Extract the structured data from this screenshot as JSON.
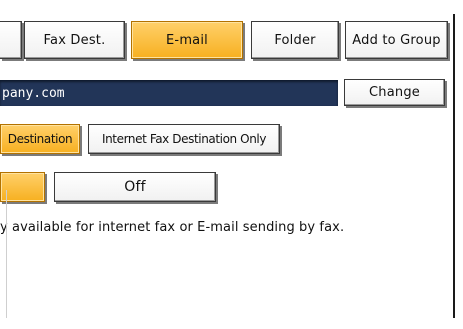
{
  "tabs": {
    "fax_dest": "Fax Dest.",
    "email": "E-mail",
    "folder": "Folder",
    "add_to_group": "Add to Group"
  },
  "address": {
    "value": "pany.com"
  },
  "change_label": "Change",
  "destination_mode": {
    "destination_label": "Destination",
    "internet_fax_only_label": "Internet Fax Destination Only"
  },
  "toggle": {
    "off_label": "Off"
  },
  "note_text": "y available for internet fax or E-mail sending by fax.",
  "colors": {
    "selected_accent": "#f7b020",
    "address_field_bg": "#223558"
  }
}
